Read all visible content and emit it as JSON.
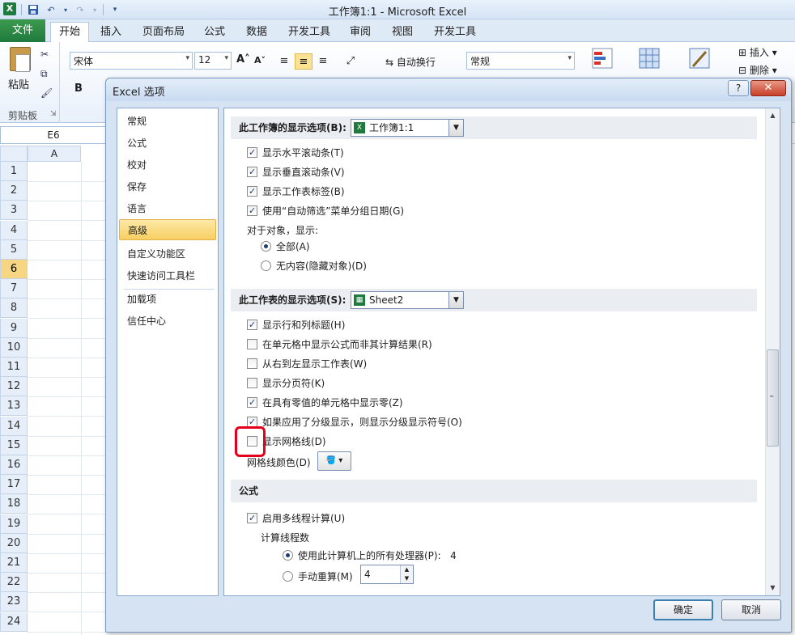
{
  "excel": {
    "logo": "X",
    "title": "工作簿1:1  -  Microsoft Excel",
    "file_tab": "文件",
    "tabs": [
      "开始",
      "插入",
      "页面布局",
      "公式",
      "数据",
      "开发工具",
      "审阅",
      "视图",
      "开发工具"
    ],
    "ribbon": {
      "paste_label": "粘贴",
      "clipboard_label": "剪贴板",
      "font_name": "宋体",
      "font_size": "12",
      "grow_font": "A",
      "shrink_font": "A",
      "bold": "B",
      "wrap_text": "自动换行",
      "number_format": "常规",
      "insert": "插入",
      "delete": "删除"
    },
    "name_box": "E6",
    "column_header": "A",
    "rows": [
      "1",
      "2",
      "3",
      "4",
      "5",
      "6",
      "7",
      "8",
      "9",
      "10",
      "11",
      "12",
      "13",
      "14",
      "15",
      "16",
      "17",
      "18",
      "19",
      "20",
      "21",
      "22",
      "23",
      "24"
    ],
    "selected_row": "6"
  },
  "dialog": {
    "title": "Excel 选项",
    "help": "?",
    "close": "✕",
    "nav": [
      "常规",
      "公式",
      "校对",
      "保存",
      "语言",
      "高级",
      "自定义功能区",
      "快速访问工具栏",
      "加载项",
      "信任中心"
    ],
    "active_nav": "高级",
    "workbook_section": {
      "label": "此工作簿的显示选项(B):",
      "combo_value": "工作簿1:1",
      "options": [
        {
          "label": "显示水平滚动条(T)",
          "checked": true
        },
        {
          "label": "显示垂直滚动条(V)",
          "checked": true
        },
        {
          "label": "显示工作表标签(B)",
          "checked": true
        },
        {
          "label": "使用“自动筛选”菜单分组日期(G)",
          "checked": true
        }
      ],
      "objects_label": "对于对象，显示:",
      "radios": [
        {
          "label": "全部(A)",
          "selected": true
        },
        {
          "label": "无内容(隐藏对象)(D)",
          "selected": false
        }
      ]
    },
    "sheet_section": {
      "label": "此工作表的显示选项(S):",
      "combo_value": "Sheet2",
      "options": [
        {
          "label": "显示行和列标题(H)",
          "checked": true
        },
        {
          "label": "在单元格中显示公式而非其计算结果(R)",
          "checked": false
        },
        {
          "label": "从右到左显示工作表(W)",
          "checked": false
        },
        {
          "label": "显示分页符(K)",
          "checked": false
        },
        {
          "label": "在具有零值的单元格中显示零(Z)",
          "checked": true
        },
        {
          "label": "如果应用了分级显示，则显示分级显示符号(O)",
          "checked": true
        },
        {
          "label": "显示网格线(D)",
          "checked": false
        }
      ],
      "gridline_color_label": "网格线颜色(D)"
    },
    "formula_section": {
      "label": "公式",
      "multithread": {
        "label": "启用多线程计算(U)",
        "checked": true
      },
      "threads_label": "计算线程数",
      "use_all": {
        "label": "使用此计算机上的所有处理器(P):",
        "value": "4",
        "selected": true
      },
      "manual": {
        "label": "手动重算(M)",
        "value": "4",
        "selected": false
      }
    },
    "ok": "确定",
    "cancel": "取消"
  },
  "colors": {
    "excel_green": "#1f7a3d",
    "highlight_red": "#e5001c",
    "nav_active": "#f8cf62"
  }
}
